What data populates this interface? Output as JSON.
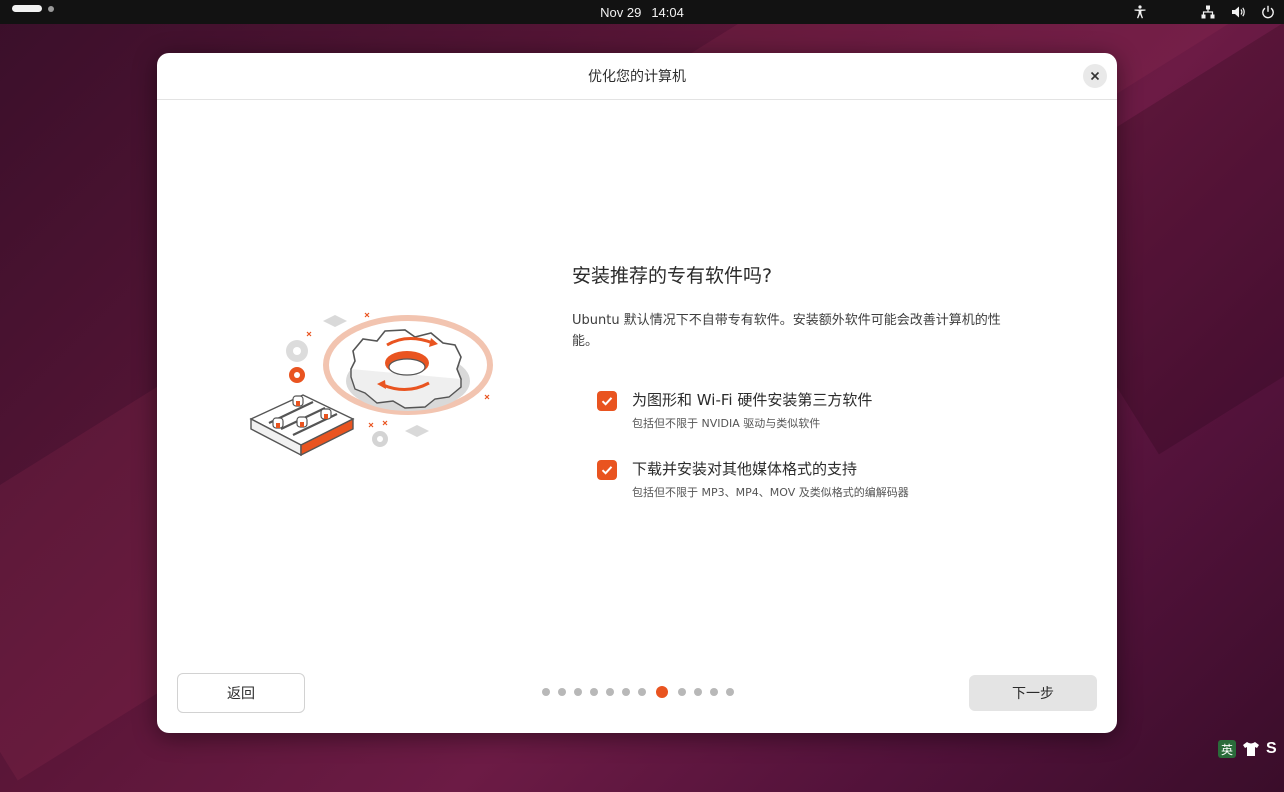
{
  "topbar": {
    "date": "Nov 29",
    "time": "14:04",
    "tray_icons": [
      "accessibility-icon",
      "network-icon",
      "volume-icon",
      "power-icon"
    ]
  },
  "dialog": {
    "title": "优化您的计算机",
    "heading": "安装推荐的专有软件吗?",
    "description": "Ubuntu 默认情况下不自带专有软件。安装额外软件可能会改善计算机的性能。",
    "options": [
      {
        "label": "为图形和 Wi-Fi 硬件安装第三方软件",
        "sublabel": "包括但不限于 NVIDIA 驱动与类似软件",
        "checked": true
      },
      {
        "label": "下载并安装对其他媒体格式的支持",
        "sublabel": "包括但不限于 MP3、MP4、MOV 及类似格式的编解码器",
        "checked": true
      }
    ],
    "back_label": "返回",
    "next_label": "下一步",
    "pager": {
      "total": 12,
      "current": 8
    }
  },
  "corner": {
    "ime_label": "英",
    "s_label": "S"
  },
  "colors": {
    "accent": "#e95420",
    "topbar": "#121212",
    "dialog_bg": "#ffffff"
  }
}
